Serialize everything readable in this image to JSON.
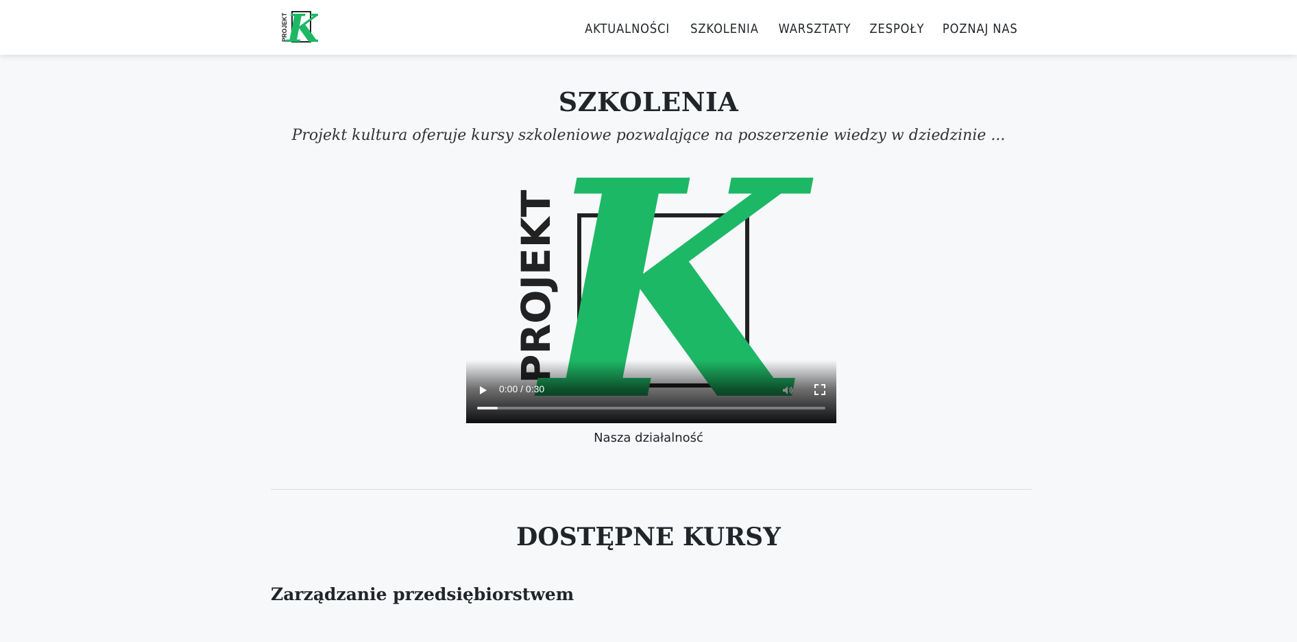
{
  "header": {
    "logo_text": "PROJEKT",
    "logo_letter": "K",
    "nav": [
      {
        "label": "AKTUALNOŚCI"
      },
      {
        "label": "SZKOLENIA"
      },
      {
        "label": "WARSZTATY"
      },
      {
        "label": "ZESPOŁY"
      },
      {
        "label": "POZNAJ NAS"
      }
    ]
  },
  "page": {
    "title": "SZKOLENIA",
    "lead": "Projekt kultura oferuje kursy szkoleniowe pozwalające na poszerzenie wiedzy w dziedzinie ..."
  },
  "video": {
    "poster_text": "PROJEKT",
    "poster_letter": "K",
    "time": "0:00 / 0:30",
    "progress_buffered": 0.06,
    "caption": "Nasza działalność"
  },
  "courses": {
    "heading": "DOSTĘPNE KURSY",
    "items": [
      {
        "title": "Zarządzanie przedsiębiorstwem"
      }
    ]
  },
  "colors": {
    "brand_green": "#1db865",
    "text": "#212529",
    "background": "#f7f8fa"
  }
}
